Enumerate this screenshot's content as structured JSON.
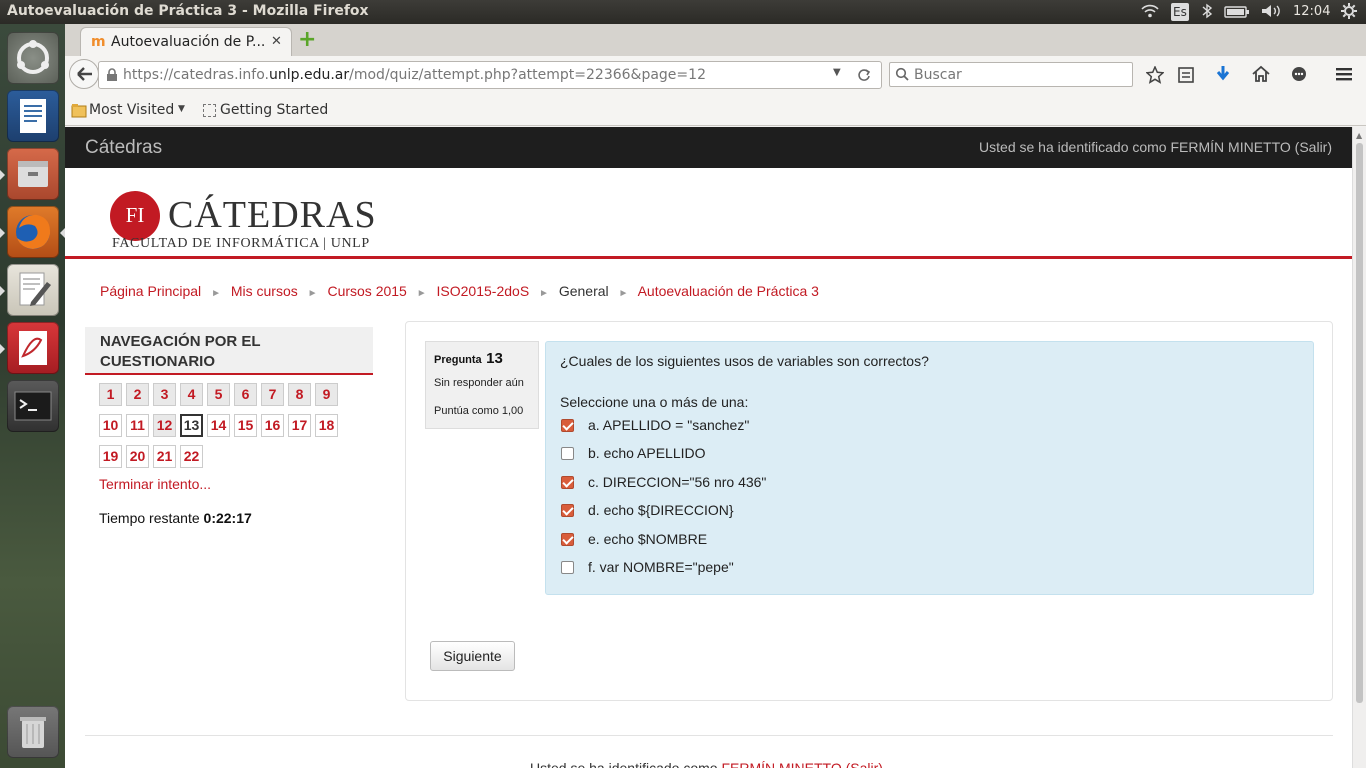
{
  "os_topbar": {
    "window_title": "Autoevaluación de Práctica 3 - Mozilla Firefox",
    "keyboard_layout": "Es",
    "time": "12:04"
  },
  "launcher": {
    "items": [
      "ubuntu-dash",
      "libreoffice-writer",
      "files",
      "firefox",
      "text-editor",
      "pdf-viewer",
      "terminal",
      "trash"
    ]
  },
  "browser": {
    "tab": {
      "title": "Autoevaluación de P...",
      "close": "✕",
      "new_tab": "+"
    },
    "url": {
      "prefix": "https://catedras.info.",
      "domain": "unlp.edu.ar",
      "path": "/mod/quiz/attempt.php?attempt=22366&page=12"
    },
    "search_placeholder": "Buscar",
    "bookmarks": {
      "most_visited": "Most Visited",
      "getting_started": "Getting Started"
    }
  },
  "page": {
    "site_name": "Cátedras",
    "login_info": "Usted se ha identificado como FERMÍN MINETTO (Salir)",
    "logo": {
      "mark": "FI",
      "title": "CÁTEDRAS",
      "subtitle": "FACULTAD DE INFORMÁTICA | UNLP"
    },
    "breadcrumb": [
      "Página Principal",
      "Mis cursos",
      "Cursos 2015",
      "ISO2015-2doS",
      "General",
      "Autoevaluación de Práctica 3"
    ],
    "breadcrumb_sep": "►",
    "nav_block": {
      "title": "NAVEGACIÓN POR EL CUESTIONARIO",
      "questions": [
        "1",
        "2",
        "3",
        "4",
        "5",
        "6",
        "7",
        "8",
        "9",
        "10",
        "11",
        "12",
        "13",
        "14",
        "15",
        "16",
        "17",
        "18",
        "19",
        "20",
        "21",
        "22"
      ],
      "finish_link": "Terminar intento...",
      "time_label": "Tiempo restante",
      "time_value": "0:22:17"
    },
    "question": {
      "label": "Pregunta",
      "number": "13",
      "state": "Sin responder aún",
      "grade": "Puntúa como 1,00",
      "text": "¿Cuales de los siguientes usos de variables son correctos?",
      "prompt": "Seleccione una o más de una:",
      "options": [
        {
          "text": "a. APELLIDO = \"sanchez\"",
          "checked": true
        },
        {
          "text": "b. echo APELLIDO",
          "checked": false
        },
        {
          "text": "c. DIRECCION=\"56 nro 436\"",
          "checked": true
        },
        {
          "text": "d. echo ${DIRECCION}",
          "checked": true
        },
        {
          "text": "e. echo $NOMBRE",
          "checked": true
        },
        {
          "text": "f. var NOMBRE=\"pepe\"",
          "checked": false
        }
      ]
    },
    "next_button": "Siguiente",
    "footer_text": "Usted se ha identificado como",
    "footer_user": "FERMÍN MINETTO",
    "footer_logout": "(Salir)"
  },
  "colors": {
    "accent": "#c21a23",
    "question_bg": "#dcedf5",
    "checked": "#d95d3b"
  }
}
